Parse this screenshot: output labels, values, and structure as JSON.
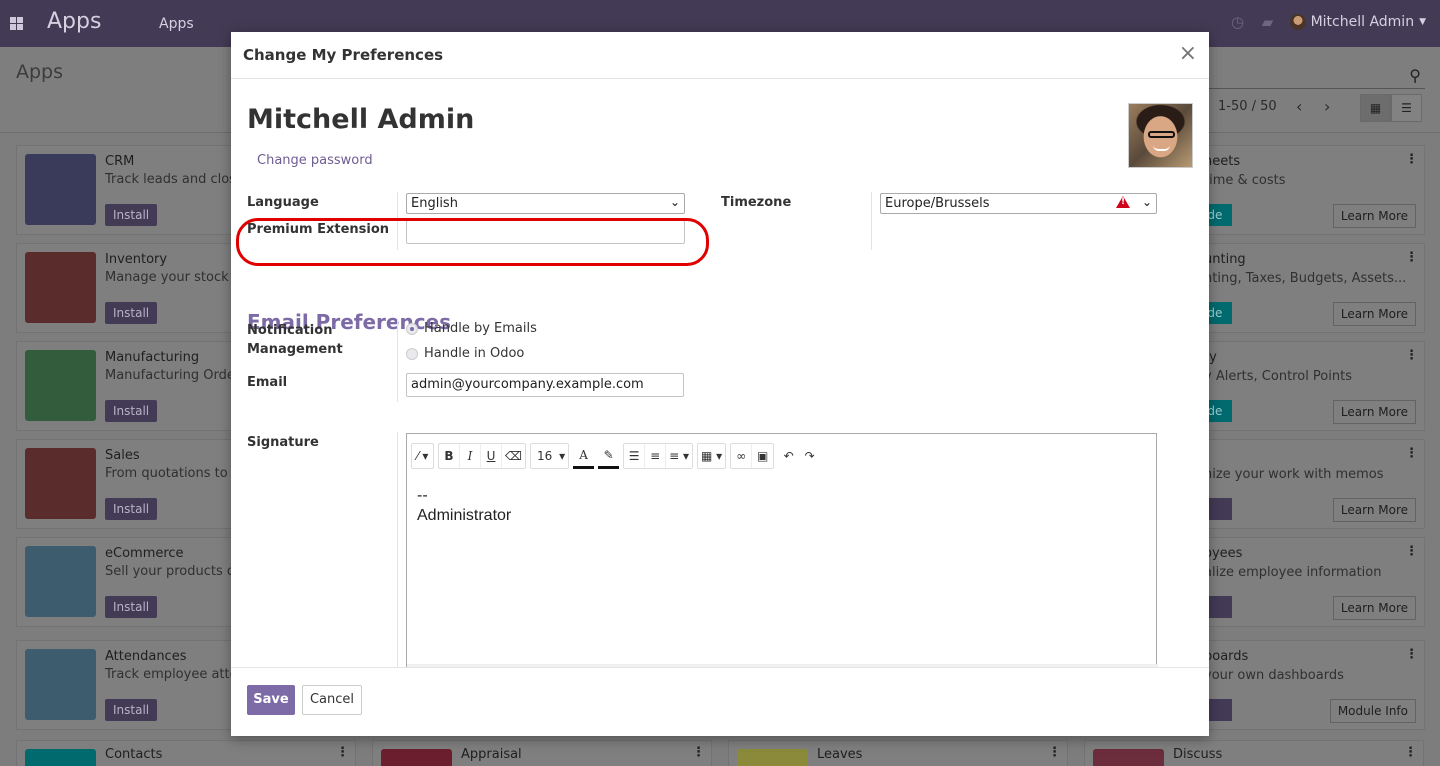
{
  "navbar": {
    "brand": "Apps",
    "menu": "Apps",
    "user": "Mitchell Admin"
  },
  "control": {
    "title": "Apps",
    "pager": "1-50 / 50"
  },
  "apps_left": [
    {
      "title": "CRM",
      "desc": "Track leads and clos",
      "button": "Install",
      "color": "#3a3a5a"
    },
    {
      "title": "Inventory",
      "desc": "Manage your stock a activities",
      "button": "Install",
      "color": "#5a2c2c"
    },
    {
      "title": "Manufacturing",
      "desc": "Manufacturing Orde",
      "button": "Install",
      "color": "#325c3c"
    },
    {
      "title": "Sales",
      "desc": "From quotations to",
      "button": "Install",
      "color": "#5a2c2c"
    },
    {
      "title": "eCommerce",
      "desc": "Sell your products o",
      "button": "Install",
      "color": "#3d5c6e"
    },
    {
      "title": "Attendances",
      "desc": "Track employee atte",
      "button": "Install",
      "color": "#3d5c6e"
    }
  ],
  "apps_right": [
    {
      "title": "heets",
      "desc": "time & costs",
      "tag": "ade",
      "more": "Learn More"
    },
    {
      "title": "unting",
      "desc": "nting, Taxes, Budgets, Assets...",
      "tag": "ade",
      "more": "Learn More"
    },
    {
      "title": "ty",
      "desc": "y Alerts, Control Points",
      "tag": "ade",
      "more": "Learn More"
    },
    {
      "title": "",
      "desc": "nize your work with memos",
      "tag": "l",
      "more": "Learn More"
    },
    {
      "title": "oyees",
      "desc": "alize employee information",
      "tag": "l",
      "more": "Learn More"
    },
    {
      "title": "boards",
      "desc": "your own dashboards",
      "tag": "l",
      "more": "Module Info"
    }
  ],
  "apps_bottom": [
    "Contacts",
    "Appraisal",
    "Leaves",
    "Discuss"
  ],
  "modal": {
    "title": "Change My Preferences",
    "close": "×",
    "user_name": "Mitchell Admin",
    "change_password": "Change password",
    "language_label": "Language",
    "language_value": "English",
    "timezone_label": "Timezone",
    "timezone_value": "Europe/Brussels",
    "premium_label": "Premium Extension",
    "premium_value": "",
    "email_prefs_title": "Email Preferences",
    "notification_label": "Notification Management",
    "notif_opt1": "Handle by Emails",
    "notif_opt2": "Handle in Odoo",
    "email_label": "Email",
    "email_value": "admin@yourcompany.example.com",
    "signature_label": "Signature",
    "signature_line1": "--",
    "signature_line2": "Administrator",
    "font_size": "16",
    "save": "Save",
    "cancel": "Cancel"
  }
}
